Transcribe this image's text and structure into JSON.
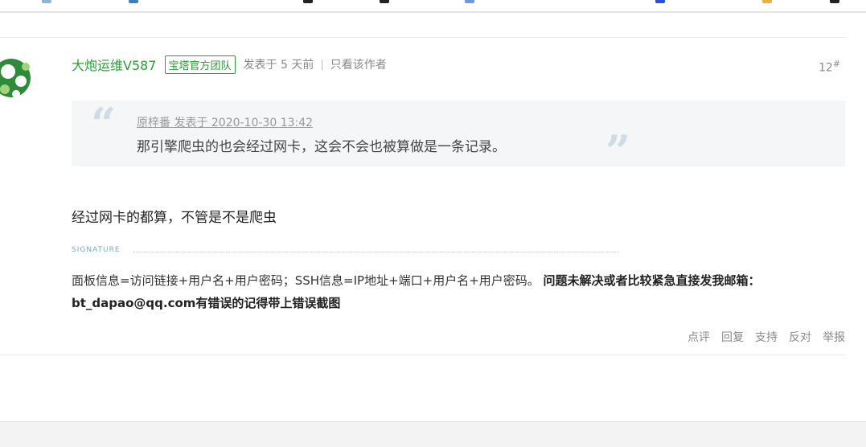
{
  "post": {
    "author": "大炮运维V587",
    "badge": "宝塔官方团队",
    "posted": "发表于 5 天前",
    "separator": "|",
    "only_author": "只看该作者",
    "floor": "12",
    "floor_mark": "#",
    "quote": {
      "open_mark": "“",
      "close_mark": "”",
      "source": "原梓番 发表于 2020-10-30 13:42",
      "text": "那引擎爬虫的也会经过网卡，这会不会也被算做是一条记录。"
    },
    "reply": "经过网卡的都算，不管是不是爬虫",
    "signature": {
      "title": "SIGNATURE",
      "normal": "面板信息=访问链接+用户名+用户密码；SSH信息=IP地址+端口+用户名+用户密码。 ",
      "bold": "问题未解决或者比较紧急直接发我邮箱：bt_dapao@qq.com有错误的记得带上错误截图"
    },
    "actions": [
      "点评",
      "回复",
      "支持",
      "反对",
      "举报"
    ]
  }
}
